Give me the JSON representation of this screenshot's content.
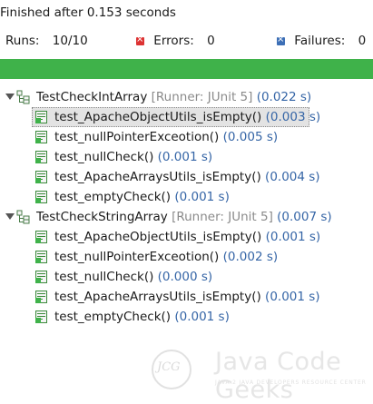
{
  "status": "Finished after 0.153 seconds",
  "counters": {
    "runs_label": "Runs:",
    "runs_value": "10/10",
    "errors_label": "Errors:",
    "errors_value": "0",
    "failures_label": "Failures:",
    "failures_value": "0"
  },
  "progress": {
    "fraction": 1.0,
    "color": "#3fb24a"
  },
  "suites": [
    {
      "name": "TestCheckIntArray",
      "runner": "[Runner: JUnit 5]",
      "time": "(0.022 s)",
      "tests": [
        {
          "name": "test_ApacheObjectUtils_isEmpty()",
          "time": "(0.003 s)",
          "selected": true
        },
        {
          "name": "test_nullPointerExceotion()",
          "time": "(0.005 s)"
        },
        {
          "name": "test_nullCheck()",
          "time": "(0.001 s)"
        },
        {
          "name": "test_ApacheArraysUtils_isEmpty()",
          "time": "(0.004 s)"
        },
        {
          "name": "test_emptyCheck()",
          "time": "(0.001 s)"
        }
      ]
    },
    {
      "name": "TestCheckStringArray",
      "runner": "[Runner: JUnit 5]",
      "time": "(0.007 s)",
      "tests": [
        {
          "name": "test_ApacheObjectUtils_isEmpty()",
          "time": "(0.001 s)"
        },
        {
          "name": "test_nullPointerExceotion()",
          "time": "(0.002 s)"
        },
        {
          "name": "test_nullCheck()",
          "time": "(0.000 s)"
        },
        {
          "name": "test_ApacheArraysUtils_isEmpty()",
          "time": "(0.001 s)"
        },
        {
          "name": "test_emptyCheck()",
          "time": "(0.001 s)"
        }
      ]
    }
  ],
  "watermark": {
    "monogram": "JCG",
    "name": "Java Code Geeks",
    "tagline": "JAVA 2 JAVA DEVELOPERS RESOURCE CENTER"
  }
}
